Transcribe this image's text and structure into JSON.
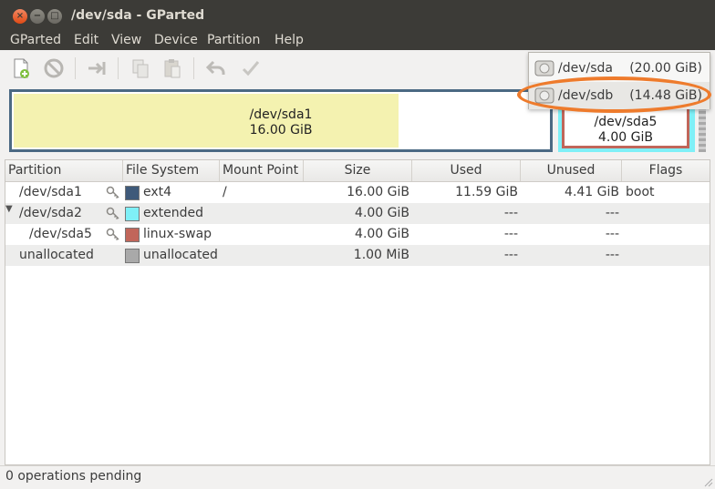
{
  "window": {
    "title": "/dev/sda - GParted"
  },
  "menubar": {
    "items": [
      "GParted",
      "Edit",
      "View",
      "Device",
      "Partition",
      "Help"
    ]
  },
  "toolbar": {
    "icons": [
      "new-icon",
      "delete-icon",
      "resize-move-icon",
      "copy-icon",
      "paste-icon",
      "undo-icon",
      "apply-icon"
    ]
  },
  "device_menu": {
    "items": [
      {
        "name": "/dev/sda",
        "size": "(20.00 GiB)"
      },
      {
        "name": "/dev/sdb",
        "size": "(14.48 GiB)"
      }
    ],
    "highlight_color": "#ee7b2c"
  },
  "disk_graph": {
    "sda1": {
      "name": "/dev/sda1",
      "size": "16.00 GiB",
      "used_fraction": 0.72
    },
    "sda5": {
      "name": "/dev/sda5",
      "size": "4.00 GiB"
    }
  },
  "table": {
    "headers": [
      "Partition",
      "File System",
      "Mount Point",
      "Size",
      "Used",
      "Unused",
      "Flags"
    ],
    "rows": [
      {
        "partition": "/dev/sda1",
        "fs": "ext4",
        "fs_color": "#3f5a7a",
        "mount": "/",
        "size": "16.00 GiB",
        "used": "11.59 GiB",
        "unused": "4.41 GiB",
        "flags": "boot"
      },
      {
        "partition": "/dev/sda2",
        "fs": "extended",
        "fs_color": "#7ff0f7",
        "mount": "",
        "size": "4.00 GiB",
        "used": "---",
        "unused": "---",
        "flags": ""
      },
      {
        "partition": "/dev/sda5",
        "fs": "linux-swap",
        "fs_color": "#c1665a",
        "mount": "",
        "size": "4.00 GiB",
        "used": "---",
        "unused": "---",
        "flags": ""
      },
      {
        "partition": "unallocated",
        "fs": "unallocated",
        "fs_color": "#a9a9a9",
        "mount": "",
        "size": "1.00 MiB",
        "used": "---",
        "unused": "---",
        "flags": ""
      }
    ]
  },
  "status": {
    "text": "0 operations pending"
  }
}
